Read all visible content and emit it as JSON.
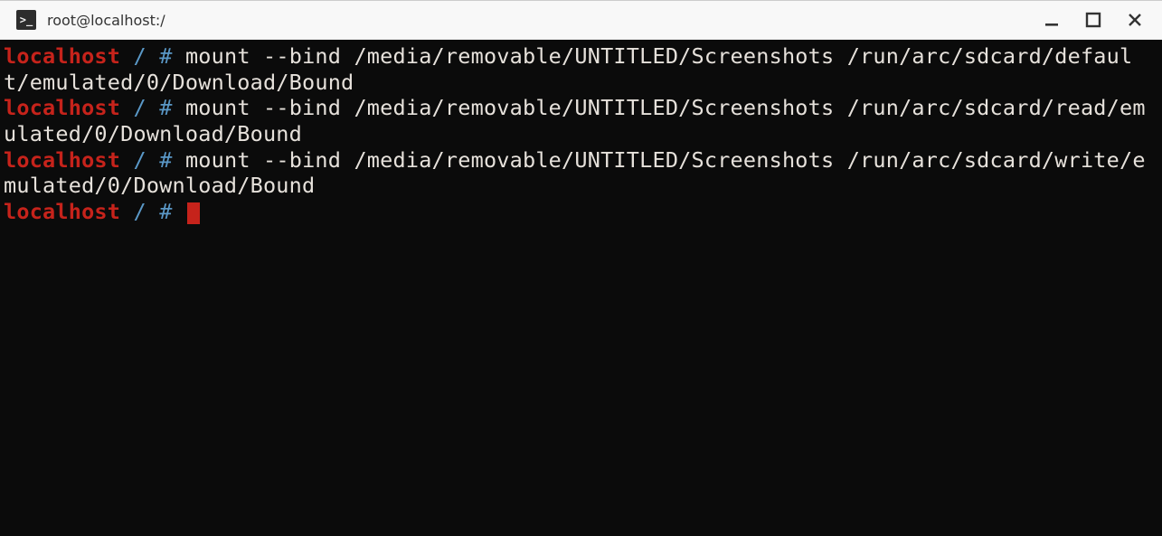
{
  "window": {
    "title": "root@localhost:/",
    "icon_glyph": ">_"
  },
  "terminal": {
    "prompt": {
      "host": "localhost",
      "path": "/",
      "hash": "#"
    },
    "commands": [
      {
        "cmd": "mount --bind /media/removable/UNTITLED/Screenshots /run/arc/sdcard/default/emulated/0/Download/Bound"
      },
      {
        "cmd": "mount --bind /media/removable/UNTITLED/Screenshots /run/arc/sdcard/read/emulated/0/Download/Bound"
      },
      {
        "cmd": "mount --bind /media/removable/UNTITLED/Screenshots /run/arc/sdcard/write/emulated/0/Download/Bound"
      }
    ],
    "colors": {
      "bg": "#0b0b0b",
      "fg": "#e6e1db",
      "host": "#c6231b",
      "path": "#5a98c7",
      "cursor": "#c6231b"
    }
  }
}
